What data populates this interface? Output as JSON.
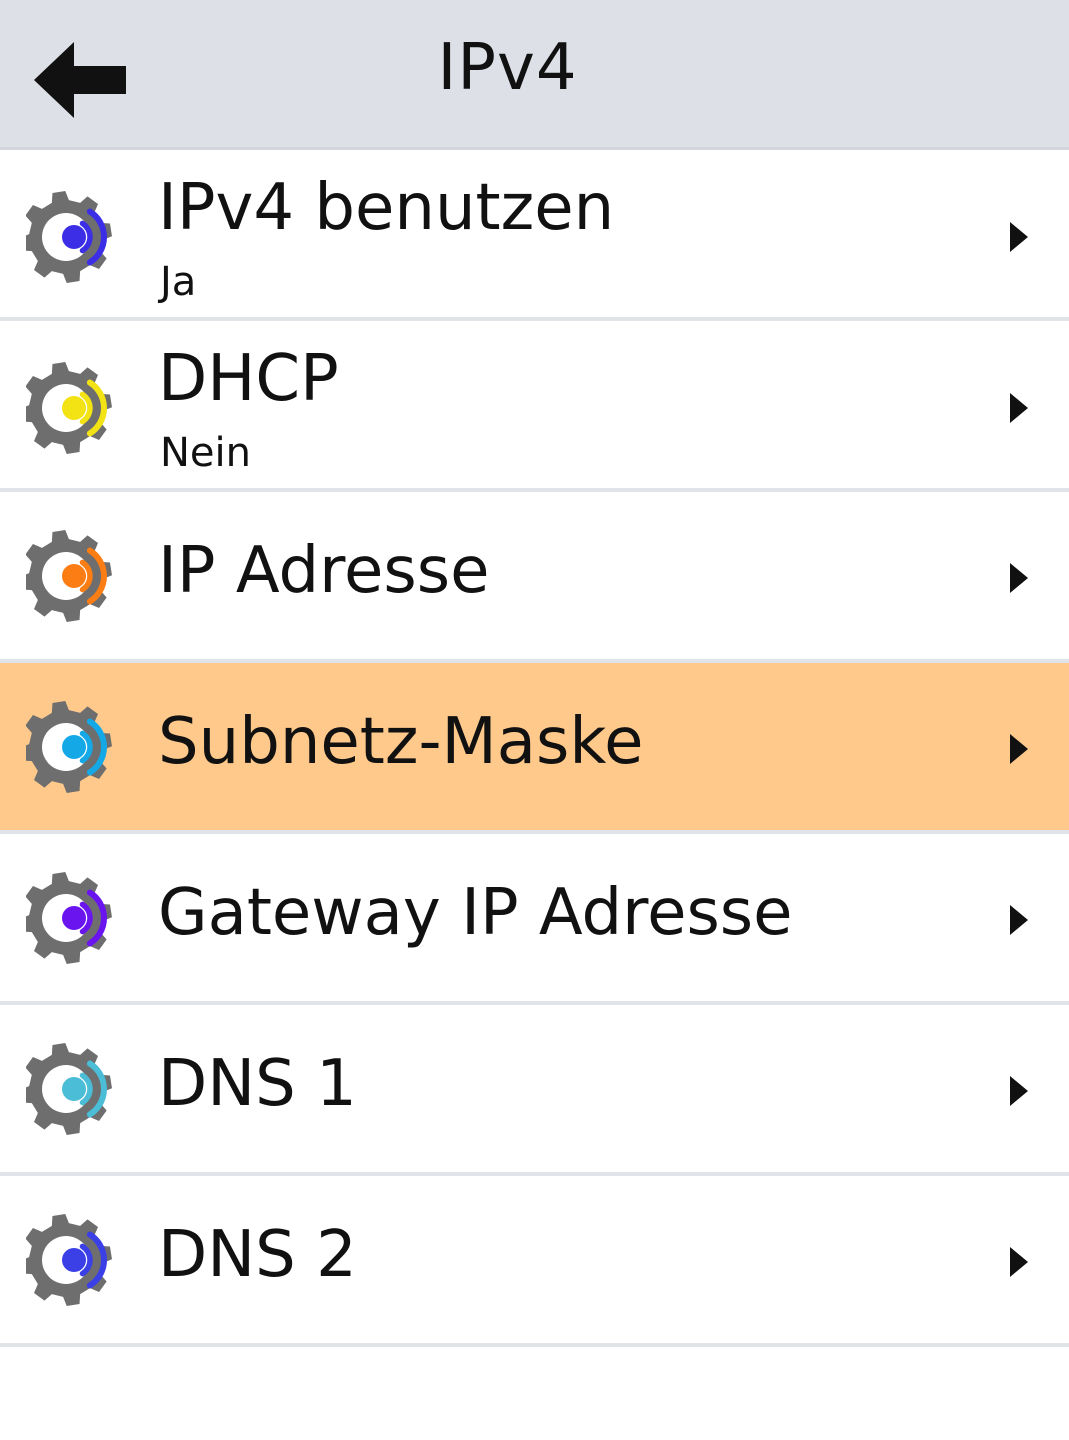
{
  "header": {
    "title": "IPv4",
    "back_icon": "back-arrow-icon"
  },
  "items": [
    {
      "label": "IPv4 benutzen",
      "value": "Ja",
      "accent": "#3b2ee6",
      "icon": "settings-wireless-icon",
      "selected": false
    },
    {
      "label": "DHCP",
      "value": "Nein",
      "accent": "#f3e214",
      "icon": "settings-wireless-icon",
      "selected": false
    },
    {
      "label": "IP Adresse",
      "accent": "#fb7d14",
      "icon": "settings-wireless-icon",
      "selected": false
    },
    {
      "label": "Subnetz-Maske",
      "accent": "#14a9e6",
      "icon": "settings-wireless-icon",
      "selected": true
    },
    {
      "label": "Gateway IP Adresse",
      "accent": "#6a14f0",
      "icon": "settings-wireless-icon",
      "selected": false
    },
    {
      "label": "DNS 1",
      "accent": "#4bbdd6",
      "icon": "settings-wireless-icon",
      "selected": false
    },
    {
      "label": "DNS 2",
      "accent": "#3a3fe6",
      "icon": "settings-wireless-icon",
      "selected": false
    }
  ],
  "colors": {
    "header_bg": "#dde1e7",
    "selected_bg": "#fec98b",
    "gear": "#6e6e6e",
    "divider": "#e0e4e9"
  }
}
